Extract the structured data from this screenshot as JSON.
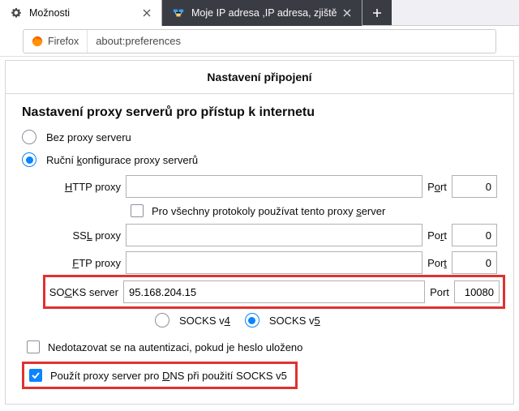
{
  "tabs": {
    "active_label": "Možnosti",
    "inactive_label": "Moje IP adresa ,IP adresa, zjiště"
  },
  "address_bar": {
    "brand": "Firefox",
    "url": "about:preferences"
  },
  "panel": {
    "title": "Nastavení připojení",
    "section": "Nastavení proxy serverů pro přístup k internetu",
    "no_proxy": "Bez proxy serveru",
    "manual": "Ruční konfigurace proxy serverů",
    "http_label": "HTTP proxy",
    "all_protocols": "Pro všechny protokoly používat tento proxy server",
    "ssl_label": "SSL proxy",
    "ftp_label": "FTP proxy",
    "socks_label": "SOCKS server",
    "port_label": "Port",
    "http_host": "",
    "http_port": "0",
    "ssl_host": "",
    "ssl_port": "0",
    "ftp_host": "",
    "ftp_port": "0",
    "socks_host": "95.168.204.15",
    "socks_port": "10080",
    "socks_v4": "SOCKS v4",
    "socks_v5": "SOCKS v5",
    "no_auth_prompt": "Nedotazovat se na autentizaci, pokud je heslo uloženo",
    "dns_over_socks": "Použít proxy server pro DNS při použití SOCKS v5"
  }
}
